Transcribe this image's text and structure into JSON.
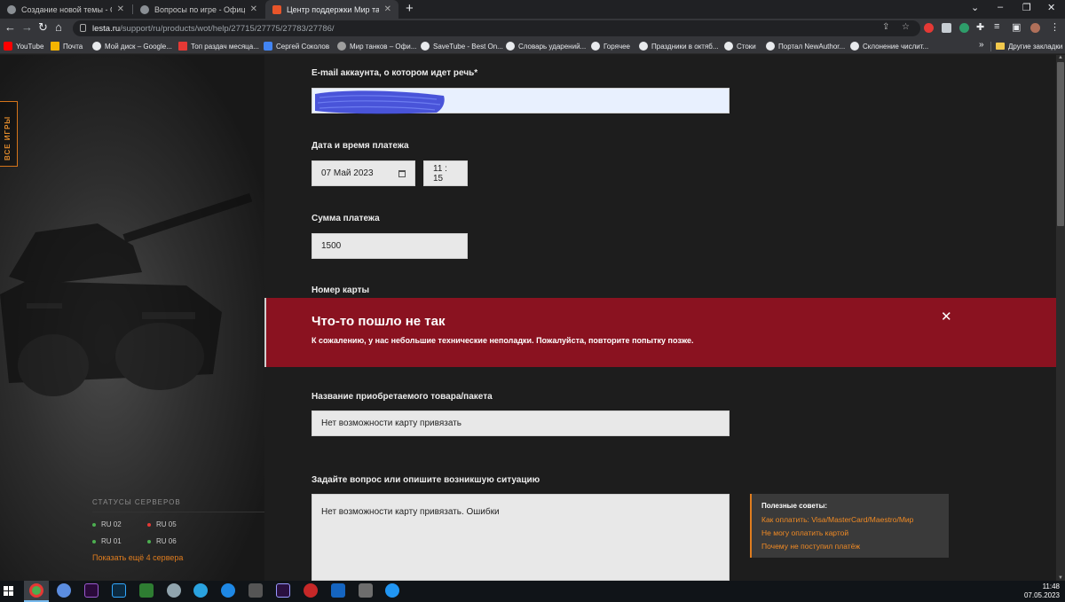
{
  "browser": {
    "tabs": [
      {
        "title": "Создание новой темы - Официа"
      },
      {
        "title": "Вопросы по игре - Официальн"
      },
      {
        "title": "Центр поддержки Мир танков |"
      }
    ],
    "new_tab": "+",
    "window_controls": {
      "dropdown": "⌄",
      "minimize": "–",
      "restore": "❐",
      "close": "✕"
    },
    "url_host": "lesta.ru",
    "url_path": "/support/ru/products/wot/help/27715/27775/27783/27786/",
    "bookmarks": [
      {
        "label": "YouTube",
        "color": "#ff0000"
      },
      {
        "label": "Почта",
        "color": "#f4b400"
      },
      {
        "label": "Мой диск – Google...",
        "color": "#e8eaed"
      },
      {
        "label": "Топ раздач месяца...",
        "color": "#e53935"
      },
      {
        "label": "Сергей Соколов",
        "color": "#4285f4"
      },
      {
        "label": "Мир танков – Офи...",
        "color": "#9e9e9e"
      },
      {
        "label": "SaveTube - Best On...",
        "color": "#e8eaed"
      },
      {
        "label": "Словарь ударений...",
        "color": "#e8eaed"
      },
      {
        "label": "Горячее",
        "color": "#e8eaed"
      },
      {
        "label": "Праздники в октяб...",
        "color": "#e8eaed"
      },
      {
        "label": "Стоки",
        "color": "#e8eaed"
      },
      {
        "label": "Портал NewAuthor...",
        "color": "#e8eaed"
      },
      {
        "label": "Склонение числит...",
        "color": "#e8eaed"
      }
    ],
    "bookmarks_more": "»",
    "other_bookmarks": "Другие закладки"
  },
  "sidebar": {
    "all_games": "ВСЕ ИГРЫ",
    "servers_title": "СТАТУСЫ СЕРВЕРОВ",
    "servers": [
      {
        "name": "RU 02",
        "status_color": "#4caf50"
      },
      {
        "name": "RU 05",
        "status_color": "#e53935"
      },
      {
        "name": "RU 01",
        "status_color": "#4caf50"
      },
      {
        "name": "RU 06",
        "status_color": "#4caf50"
      }
    ],
    "show_more": "Показать ещё 4 сервера"
  },
  "form": {
    "email_label": "E-mail аккаунта, о котором идет речь*",
    "email_value": "",
    "datetime_label": "Дата и время платежа",
    "date_value": "07 Май 2023",
    "time_value": "11 : 15",
    "amount_label": "Сумма платежа",
    "amount_value": "1500",
    "card_label": "Номер карты",
    "product_label": "Название приобретаемого товара/пакета",
    "product_value": "Нет возможности карту привязать",
    "question_label": "Задайте вопрос или опишите возникшую ситуацию",
    "question_value": "Нет возможности карту привязать. Ошибки"
  },
  "error": {
    "title": "Что-то пошло не так",
    "message": "К сожалению, у нас небольшие технические неполадки. Пожалуйста, повторите попытку позже.",
    "close": "✕",
    "color": "#8a1220"
  },
  "tips": {
    "title": "Полезные советы:",
    "links": [
      "Как оплатить: Visa/MasterCard/Maestro/Мир",
      "Не могу оплатить картой",
      "Почему не поступил платёж"
    ],
    "accent": "#e07d1f"
  },
  "taskbar": {
    "time": "11:48",
    "date": "07.05.2023"
  }
}
